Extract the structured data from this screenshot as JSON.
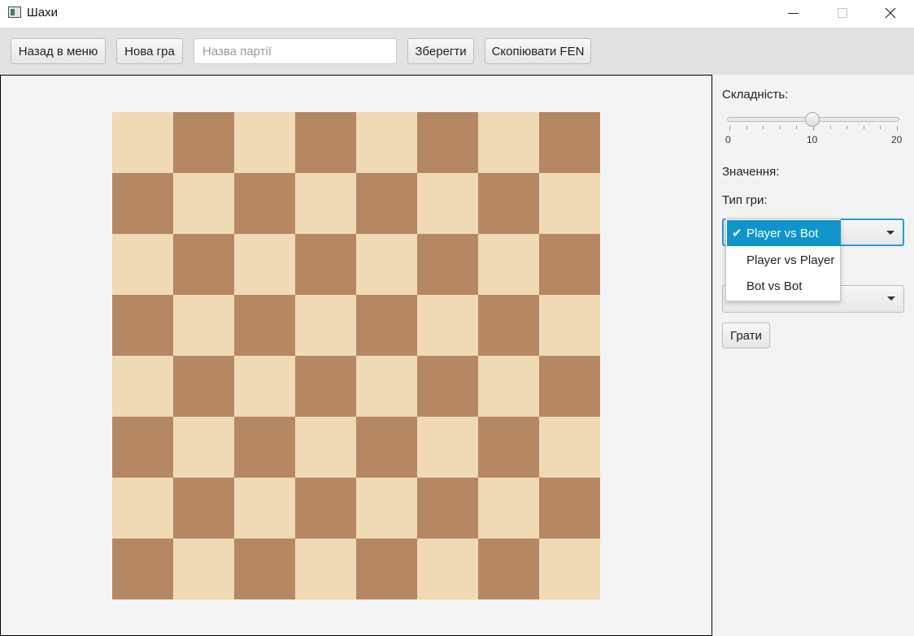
{
  "window": {
    "title": "Шахи",
    "icon": "app-window-icon"
  },
  "toolbar": {
    "back_label": "Назад в меню",
    "new_game_label": "Нова гра",
    "game_name_placeholder": "Назва партії",
    "game_name_value": "",
    "save_label": "Зберегти",
    "copy_fen_label": "Скопіювати FEN"
  },
  "board": {
    "size": 8,
    "light_color": "#f0d9b5",
    "dark_color": "#b58863"
  },
  "panel": {
    "difficulty_label": "Складність:",
    "difficulty": {
      "min": 0,
      "max": 20,
      "value": 10,
      "ticks": [
        "0",
        "10",
        "20"
      ]
    },
    "value_label": "Значення:",
    "game_type_label": "Тип гри:",
    "game_type_selected": "Player vs Bot",
    "game_type_options": [
      "Player vs Bot",
      "Player vs Player",
      "Bot vs Bot"
    ],
    "play_label": "Грати",
    "accent_color": "#0f95cc"
  }
}
